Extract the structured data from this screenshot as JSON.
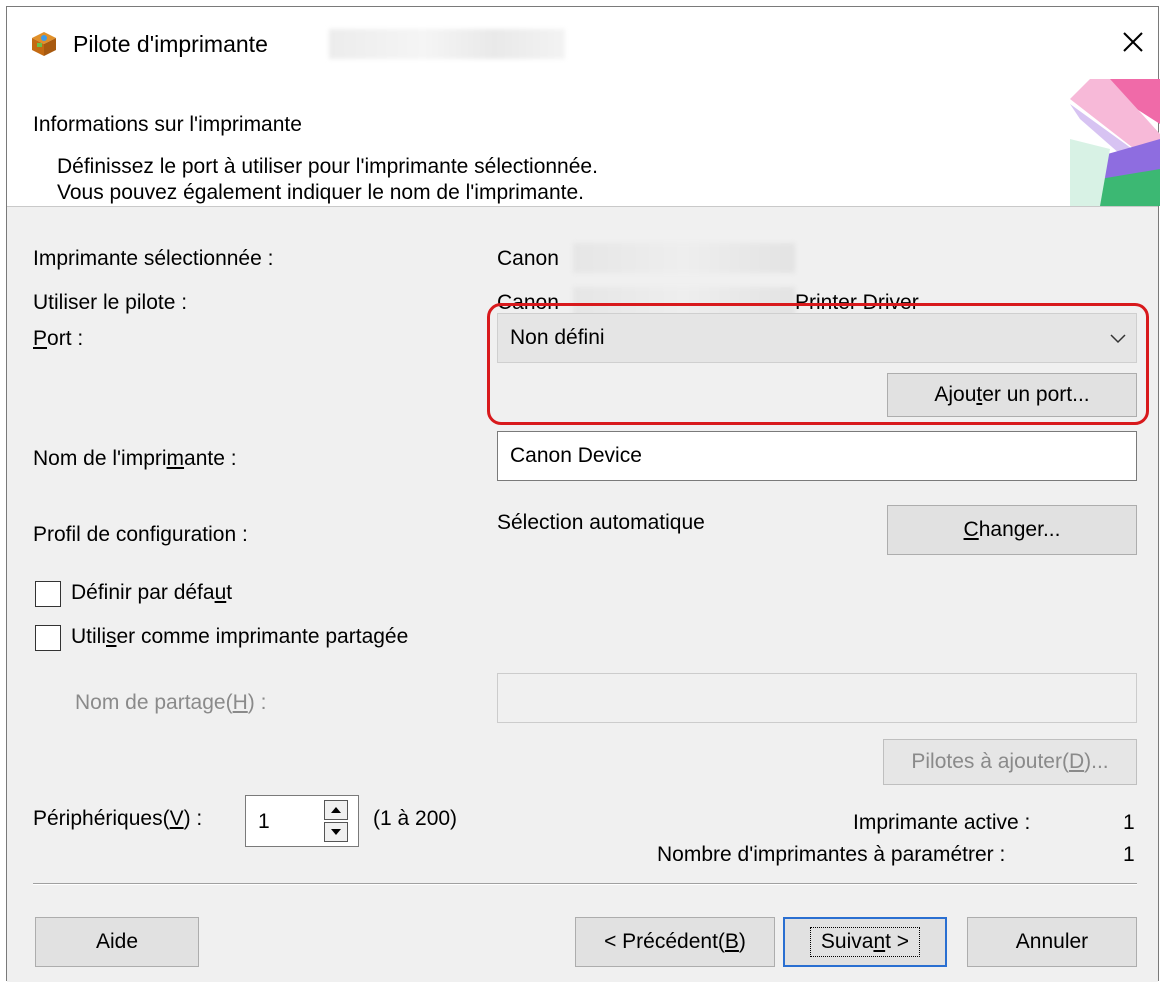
{
  "window": {
    "title": "Pilote d'imprimante",
    "close_icon": "close-icon"
  },
  "header": {
    "title": "Informations sur l'imprimante",
    "line1": "Définissez le port à utiliser pour l'imprimante sélectionnée.",
    "line2": "Vous pouvez également indiquer le nom de l'imprimante."
  },
  "form": {
    "selected_printer_label": "Imprimante sélectionnée :",
    "selected_printer_value": "Canon",
    "driver_label": "Utiliser le pilote :",
    "driver_value_prefix": "Canon",
    "driver_value_suffix": "Printer Driver",
    "port_label_u": "P",
    "port_label_rest": "ort :",
    "port_value": "Non défini",
    "add_port_pre": "Ajou",
    "add_port_u": "t",
    "add_port_post": "er un port...",
    "printer_name_label_pre": "Nom de l'impri",
    "printer_name_label_u": "m",
    "printer_name_label_post": "ante :",
    "printer_name_value": "Canon Device",
    "config_profile_label": "Profil de configuration :",
    "config_profile_value": "Sélection automatique",
    "change_u": "C",
    "change_rest": "hanger...",
    "set_default_pre": "Définir par défa",
    "set_default_u": "u",
    "set_default_post": "t",
    "shared_pre": "Utili",
    "shared_u": "s",
    "shared_post": "er comme imprimante partagée",
    "share_name_pre": "Nom de partage(",
    "share_name_u": "H",
    "share_name_post": ") :",
    "share_name_value": "",
    "drivers_pre": "Pilotes à ajouter(",
    "drivers_u": "D",
    "drivers_post": ")...",
    "devices_pre": "Périphériques(",
    "devices_u": "V",
    "devices_post": ") :",
    "devices_value": "1",
    "devices_range": "(1 à 200)",
    "active_printer_label": "Imprimante active :",
    "active_printer_value": "1",
    "printers_to_configure_label": "Nombre d'imprimantes à paramétrer :",
    "printers_to_configure_value": "1"
  },
  "footer": {
    "help": "Aide",
    "back_pre": "< Précédent(",
    "back_u": "B",
    "back_post": ")",
    "next_pre": "Suiva",
    "next_u": "n",
    "next_post": "t >",
    "cancel": "Annuler"
  },
  "colors": {
    "highlight": "#d8191c",
    "default_button_border": "#2a6fd1"
  }
}
